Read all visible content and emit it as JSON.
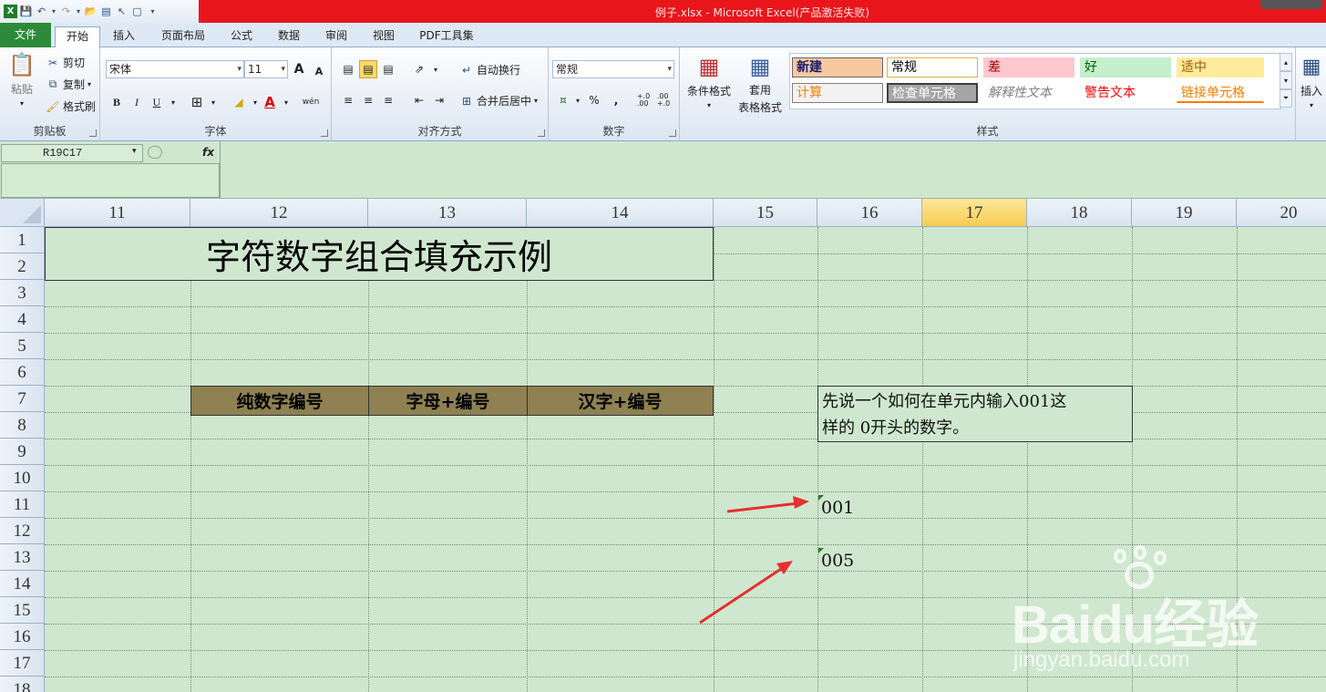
{
  "window": {
    "title": "例子.xlsx - Microsoft Excel(产品激活失败)"
  },
  "tabs": [
    "文件",
    "开始",
    "插入",
    "页面布局",
    "公式",
    "数据",
    "审阅",
    "视图",
    "PDF工具集"
  ],
  "ribbon": {
    "clipboard": {
      "label": "剪贴板",
      "paste": "粘贴",
      "cut": "剪切",
      "copy": "复制",
      "format_painter": "格式刷"
    },
    "font": {
      "label": "字体",
      "font_name": "宋体",
      "font_size": "11",
      "bold": "B",
      "italic": "I",
      "underline": "U",
      "grow": "A",
      "shrink": "A",
      "font_color": "A",
      "phonetic": "wén"
    },
    "alignment": {
      "label": "对齐方式",
      "wrap_text": "自动换行",
      "merge_center": "合并后居中"
    },
    "number": {
      "label": "数字",
      "format": "常规",
      "percent": "%",
      "comma": ",",
      "inc_decimal": "+.0\n.00",
      "dec_decimal": ".00\n+.0"
    },
    "styles": {
      "label": "样式",
      "conditional_format": "条件格式",
      "table_format_line1": "套用",
      "table_format_line2": "表格格式",
      "cells": [
        {
          "text": "新建",
          "color": "#1a1a6e",
          "bg": "#f8c9a0",
          "border": "#666"
        },
        {
          "text": "常规",
          "color": "#000",
          "bg": "#ffffff",
          "border": "#e0b040"
        },
        {
          "text": "差",
          "color": "#9c0006",
          "bg": "#ffc7ce",
          "border": "transparent"
        },
        {
          "text": "好",
          "color": "#006100",
          "bg": "#c6efce",
          "border": "transparent"
        },
        {
          "text": "适中",
          "color": "#9c5700",
          "bg": "#ffeb9c",
          "border": "transparent"
        },
        {
          "text": "计算",
          "color": "#fa7d00",
          "bg": "#f2f2f2",
          "border": "#7f7f7f"
        },
        {
          "text": "检查单元格",
          "color": "#ffffff",
          "bg": "#a5a5a5",
          "border": "#3f3f3f"
        },
        {
          "text": "解释性文本",
          "color": "#7f7f7f",
          "bg": "transparent",
          "border": "transparent"
        },
        {
          "text": "警告文本",
          "color": "#ff0000",
          "bg": "transparent",
          "border": "transparent"
        },
        {
          "text": "链接单元格",
          "color": "#fa7d00",
          "bg": "transparent",
          "border": "transparent"
        }
      ]
    },
    "cells_group": {
      "insert": "插入"
    }
  },
  "formula_bar": {
    "name_box": "R19C17",
    "fx": "fx",
    "formula": ""
  },
  "columns": [
    "11",
    "12",
    "13",
    "14",
    "15",
    "16",
    "17",
    "18",
    "19",
    "20"
  ],
  "selected_column": "17",
  "rows": [
    "1",
    "2",
    "3",
    "4",
    "5",
    "6",
    "7",
    "8",
    "9",
    "10",
    "11",
    "12",
    "13",
    "14",
    "15",
    "16",
    "17",
    "18"
  ],
  "sheet": {
    "title": "字符数字组合填充示例",
    "headers": [
      "纯数字编号",
      "字母+编号",
      "汉字+编号"
    ],
    "note_line1": "先说一个如何在单元内输入001这",
    "note_line2": "样的 0开头的数字。",
    "value_r11": "001",
    "value_r13": "005"
  },
  "watermark": {
    "logo": "Baidu经验",
    "url": "jingyan.baidu.com"
  }
}
